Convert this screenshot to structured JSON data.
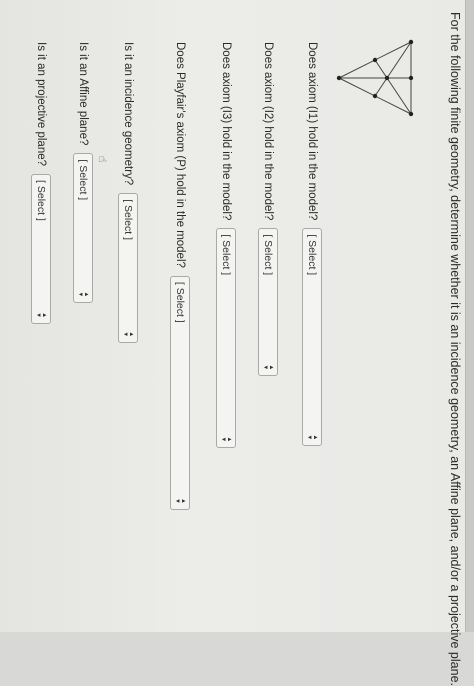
{
  "prompt": "For the following finite geometry, determine whether it is an incidence geometry, an Affine plane, and/or a projective plane.",
  "questions": [
    {
      "text": "Does axiom (I1) hold in the model?",
      "select": "[ Select ]"
    },
    {
      "text": "Does axiom (I2) hold in the model?",
      "select": "[ Select ]"
    },
    {
      "text": "Does axiom (I3) hold in the model?",
      "select": "[ Select ]"
    },
    {
      "text": "Does Playfair's axiom (P) hold in the model?",
      "select": "[ Select ]"
    },
    {
      "text": "Is it an incidence geometry?",
      "select": "[ Select ]"
    },
    {
      "text": "Is it an Affine plane?",
      "select": "[ Select ]"
    },
    {
      "text": "Is it an projective plane?",
      "select": "[ Select ]"
    }
  ],
  "icons": {
    "cursor": "cursor-hand-icon"
  }
}
